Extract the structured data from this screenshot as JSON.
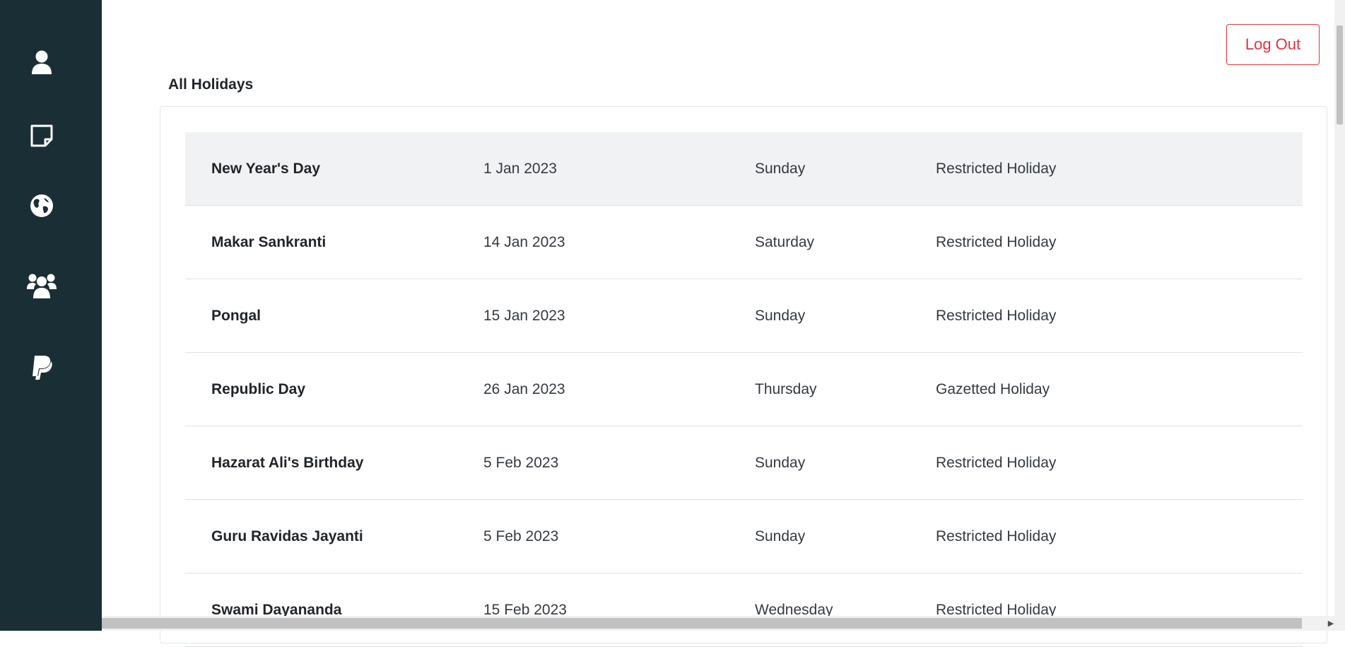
{
  "sidebar": {
    "items": [
      {
        "icon": "user-icon"
      },
      {
        "icon": "sticky-note-icon"
      },
      {
        "icon": "globe-icon"
      },
      {
        "icon": "users-group-icon"
      },
      {
        "icon": "paypal-icon"
      }
    ]
  },
  "header": {
    "logout_label": "Log Out"
  },
  "main": {
    "title": "All Holidays",
    "holidays": [
      {
        "name": "New Year's Day",
        "date": "1 Jan 2023",
        "day": "Sunday",
        "type": "Restricted Holiday"
      },
      {
        "name": "Makar Sankranti",
        "date": "14 Jan 2023",
        "day": "Saturday",
        "type": "Restricted Holiday"
      },
      {
        "name": "Pongal",
        "date": "15 Jan 2023",
        "day": "Sunday",
        "type": "Restricted Holiday"
      },
      {
        "name": "Republic Day",
        "date": "26 Jan 2023",
        "day": "Thursday",
        "type": "Gazetted Holiday"
      },
      {
        "name": "Hazarat Ali's Birthday",
        "date": "5 Feb 2023",
        "day": "Sunday",
        "type": "Restricted Holiday"
      },
      {
        "name": "Guru Ravidas Jayanti",
        "date": "5 Feb 2023",
        "day": "Sunday",
        "type": "Restricted Holiday"
      },
      {
        "name": "Swami Dayananda",
        "date": "15 Feb 2023",
        "day": "Wednesday",
        "type": "Restricted Holiday"
      }
    ]
  },
  "colors": {
    "sidebar_bg": "#1a2e35",
    "logout_accent": "#dc3545",
    "highlight_row": "#f1f2f4"
  }
}
